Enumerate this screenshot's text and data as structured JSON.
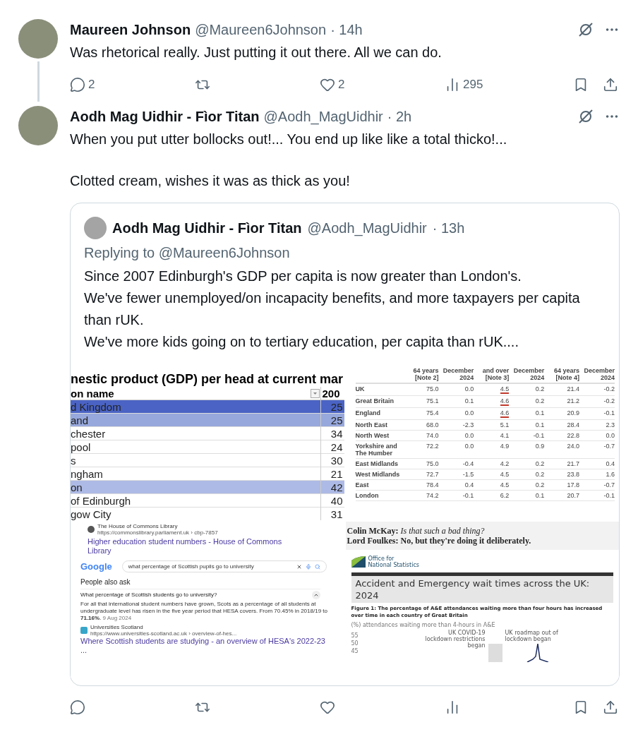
{
  "posts": [
    {
      "author": "Maureen Johnson",
      "handle": "@Maureen6Johnson",
      "time": "· 14h",
      "paragraphs": [
        "Was rhetorical really.  Just putting it out there. All we can do."
      ],
      "thread_line": true,
      "actions": [
        {
          "kind": "reply",
          "count": "2"
        },
        {
          "kind": "repost"
        },
        {
          "kind": "like",
          "count": "2"
        },
        {
          "kind": "views",
          "count": "295"
        },
        {
          "kind": "bookmark"
        },
        {
          "kind": "share"
        }
      ]
    },
    {
      "author": "Aodh Mag Uidhir - Fìor Titan",
      "handle": "@Aodh_MagUidhir",
      "time": "· 2h",
      "paragraphs": [
        "When you put utter bollocks out!... You end up like like a total thicko!...",
        "Clotted cream, wishes it was as thick as you!"
      ],
      "thread_line": false,
      "quote": {
        "author": "Aodh Mag Uidhir - Fìor Titan",
        "handle": "@Aodh_MagUidhir",
        "time": "· 13h",
        "replying_label": "Replying to",
        "replying_to": "@Maureen6Johnson",
        "lines": [
          "Since 2007 Edinburgh's GDP per capita is now greater than London's.",
          "We've fewer unemployed/on incapacity benefits, and more taxpayers per capita than rUK.",
          "We've more kids going on to tertiary education, per capita than rUK...."
        ],
        "gdp_table": {
          "title": "nestic product (GDP) per head at current mar",
          "header": [
            "on name",
            "200"
          ],
          "rows": [
            {
              "name": "d Kingdom",
              "value": "25",
              "color": "#4a63c4"
            },
            {
              "name": "and",
              "value": "25",
              "color": "#97a8dc"
            },
            {
              "name": "chester",
              "value": "34",
              "color": "#ffffff"
            },
            {
              "name": "pool",
              "value": "24",
              "color": "#ffffff"
            },
            {
              "name": "s",
              "value": "30",
              "color": "#ffffff"
            },
            {
              "name": "ngham",
              "value": "21",
              "color": "#ffffff"
            },
            {
              "name": "on",
              "value": "42",
              "color": "#adbae6"
            },
            {
              "name": "of Edinburgh",
              "value": "40",
              "color": "#ffffff"
            },
            {
              "name": "gow City",
              "value": "31",
              "color": "#ffffff"
            }
          ]
        },
        "region_table": {
          "columns": [
            "64 years [Note 2]",
            "December 2024",
            "and over [Note 3]",
            "December 2024",
            "64 years [Note 4]",
            "December 2024"
          ],
          "rows": [
            {
              "region": "UK",
              "values": [
                "75.0",
                "0.0",
                "4.5",
                "0.2",
                "21.4",
                "-0.2"
              ],
              "underlined": true
            },
            {
              "region": "Great Britain",
              "values": [
                "75.1",
                "0.1",
                "4.6",
                "0.2",
                "21.2",
                "-0.2"
              ],
              "underlined": true
            },
            {
              "region": "England",
              "values": [
                "75.4",
                "0.0",
                "4.6",
                "0.1",
                "20.9",
                "-0.1"
              ],
              "underlined": true
            },
            {
              "region": "North East",
              "values": [
                "68.0",
                "-2.3",
                "5.1",
                "0.1",
                "28.4",
                "2.3"
              ],
              "underlined": false
            },
            {
              "region": "North West",
              "values": [
                "74.0",
                "0.0",
                "4.1",
                "-0.1",
                "22.8",
                "0.0"
              ],
              "underlined": false
            },
            {
              "region": "Yorkshire and The Humber",
              "values": [
                "72.2",
                "0.0",
                "4.9",
                "0.9",
                "24.0",
                "-0.7"
              ],
              "underlined": false
            },
            {
              "region": "East Midlands",
              "values": [
                "75.0",
                "-0.4",
                "4.2",
                "0.2",
                "21.7",
                "0.4"
              ],
              "underlined": false
            },
            {
              "region": "West Midlands",
              "values": [
                "72.7",
                "-1.5",
                "4.5",
                "0.2",
                "23.8",
                "1.6"
              ],
              "underlined": false
            },
            {
              "region": "East",
              "values": [
                "78.4",
                "0.4",
                "4.5",
                "0.2",
                "17.8",
                "-0.7"
              ],
              "underlined": false
            },
            {
              "region": "London",
              "values": [
                "74.2",
                "-0.1",
                "6.2",
                "0.1",
                "20.7",
                "-0.1"
              ],
              "underlined": false
            }
          ]
        },
        "search_result": {
          "source": "The House of Commons Library",
          "url": "https://commonslibrary.parliament.uk › cbp-7857",
          "title": "Higher education student numbers - House of Commons Library",
          "logo": "Google",
          "query": "what percentage of Scottish pupils go to university",
          "section": "People also ask",
          "question": "What percentage of Scottish students go to university?",
          "answer": "For all that international student numbers have grown, Scots as a percentage of all students at undergraduate level has risen in the five year period that HESA covers. From 70.45% in 2018/19 to **71.16%**.",
          "answer_date": "9 Aug 2024",
          "source2": "Universities Scotland",
          "url2": "https://www.universities-scotland.ac.uk › overview-of-hes...",
          "title2": "Where Scottish students are studying - an overview of HESA's 2022-23 ..."
        },
        "ons": {
          "quotes": [
            {
              "speaker": "Colin McKay:",
              "words": "Is that such a bad thing?"
            },
            {
              "speaker": "Lord Foulkes:",
              "words": "No, but they're doing it deliberately."
            }
          ],
          "org": [
            "Office for",
            "National Statistics"
          ],
          "title": "Accident and Emergency wait times across the UK: 2024",
          "figure": "Figure 1: The percentage of A&E attendances waiting more than four hours has increased over time in each country of Great Britain",
          "axis_title": "(%) attendances waiting more than 4-hours in A&E",
          "ticks": [
            "55",
            "50",
            "45"
          ],
          "notes": [
            "UK COVID-19 lockdown restrictions began",
            "UK roadmap out of lockdown began"
          ]
        }
      },
      "actions": [
        {
          "kind": "reply"
        },
        {
          "kind": "repost"
        },
        {
          "kind": "like"
        },
        {
          "kind": "views"
        },
        {
          "kind": "bookmark"
        },
        {
          "kind": "share"
        }
      ]
    }
  ]
}
